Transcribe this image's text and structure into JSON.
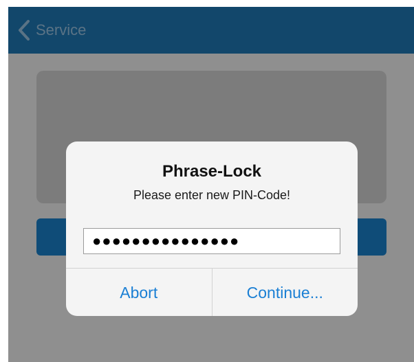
{
  "navbar": {
    "back_label": "Service",
    "back_icon": "chevron-left-icon",
    "color": "#1f7ab8"
  },
  "dialog": {
    "title": "Phrase-Lock",
    "message": "Please enter new PIN-Code!",
    "pin_value": "●●●●●●●●●●●●●●●",
    "abort_label": "Abort",
    "continue_label": "Continue...",
    "button_color": "#1a7fd4"
  }
}
